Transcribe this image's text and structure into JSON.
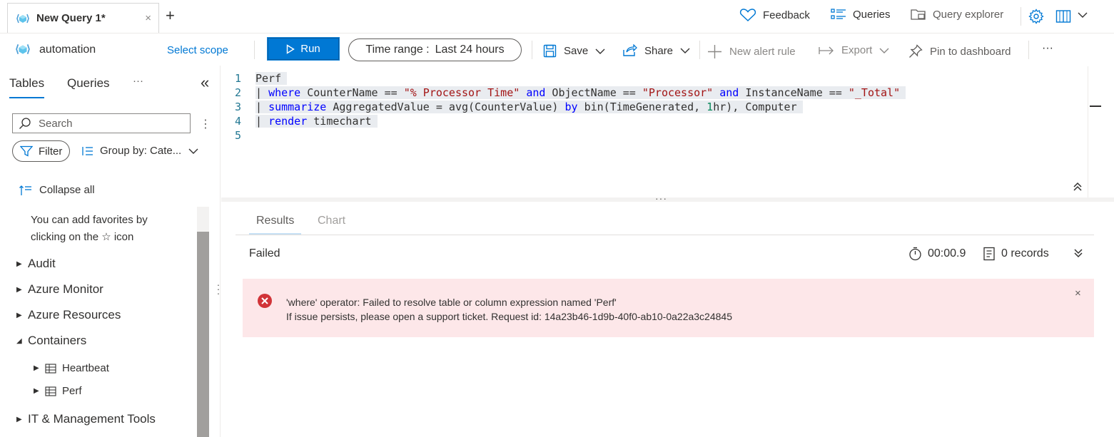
{
  "tab": {
    "title": "New Query 1*",
    "close": "×",
    "new_tab": "+"
  },
  "top_actions": {
    "feedback": "Feedback",
    "queries": "Queries",
    "query_explorer": "Query explorer"
  },
  "command_bar": {
    "scope_name": "automation",
    "select_scope": "Select scope",
    "run": "Run",
    "time_range_label": "Time range :",
    "time_range_value": "Last 24 hours",
    "save": "Save",
    "share": "Share",
    "new_alert_rule": "New alert rule",
    "export": "Export",
    "pin_to_dashboard": "Pin to dashboard",
    "more": "···"
  },
  "left_panel": {
    "tabs": [
      "Tables",
      "Queries"
    ],
    "more": "···",
    "collapse": "«",
    "search_placeholder": "Search",
    "kebab": "⋮",
    "filter": "Filter",
    "group_by": "Group by: Cate...",
    "collapse_all": "Collapse all",
    "favorites_note_1": "You can add favorites by",
    "favorites_note_2": "clicking on the ☆ icon",
    "tree": [
      {
        "label": "Audit",
        "expanded": false
      },
      {
        "label": "Azure Monitor",
        "expanded": false
      },
      {
        "label": "Azure Resources",
        "expanded": false
      },
      {
        "label": "Containers",
        "expanded": true
      },
      {
        "label": "Heartbeat",
        "child": true
      },
      {
        "label": "Perf",
        "child": true
      },
      {
        "label": "IT & Management Tools",
        "expanded": false
      }
    ]
  },
  "editor": {
    "line_numbers": [
      "1",
      "2",
      "3",
      "4",
      "5"
    ],
    "lines": [
      "Perf",
      "| where CounterName == \"% Processor Time\" and ObjectName == \"Processor\" and InstanceName == \"_Total\"",
      "| summarize AggregatedValue = avg(CounterValue) by bin(TimeGenerated, 1hr), Computer",
      "| render timechart",
      ""
    ]
  },
  "results": {
    "tabs": [
      "Results",
      "Chart"
    ],
    "status": "Failed",
    "duration": "00:00.9",
    "records": "0 records",
    "error_line_1": "'where' operator: Failed to resolve table or column expression named 'Perf'",
    "error_line_2": "If issue persists, please open a support ticket. Request id: 14a23b46-1d9b-40f0-ab10-0a22a3c24845",
    "error_close": "×"
  },
  "colors": {
    "accent": "#0078d4",
    "error_bg": "#fde7e9",
    "error_icon": "#d13438",
    "keyword": "#0000ff",
    "string": "#a31515"
  }
}
